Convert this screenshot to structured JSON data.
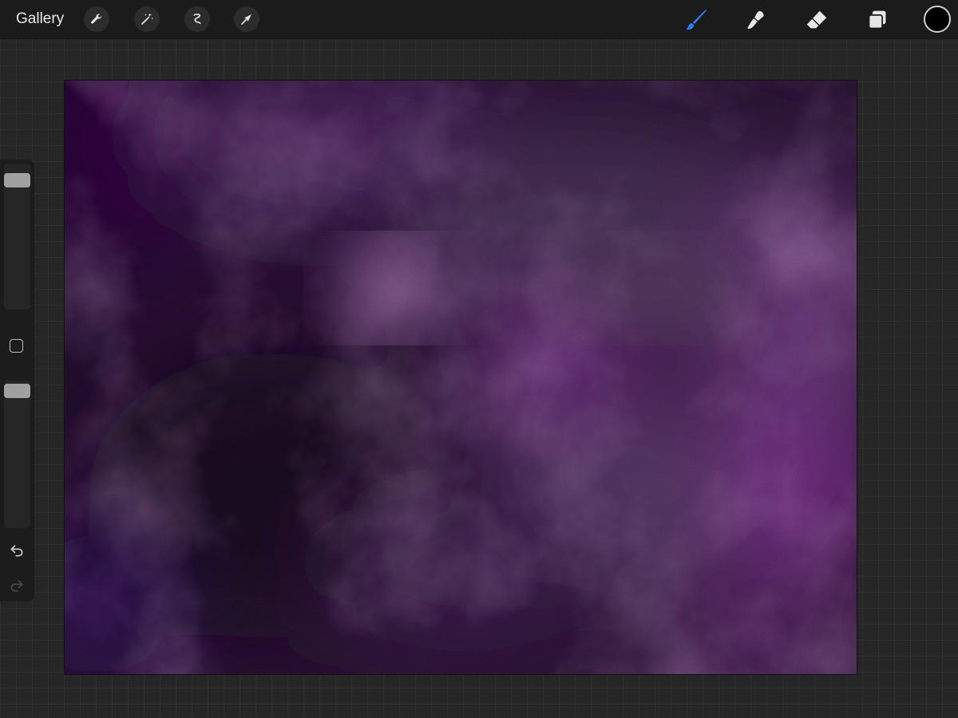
{
  "toolbar": {
    "gallery_label": "Gallery",
    "left_tools": [
      "actions-wrench-icon",
      "adjustments-magic-wand-icon",
      "selection-icon",
      "transform-arrow-icon"
    ],
    "right_tools": [
      "brush-icon",
      "smudge-icon",
      "eraser-icon",
      "layers-icon"
    ],
    "active_tool": "brush-icon",
    "active_color": "#000000",
    "accent_color": "#2f7ef5"
  },
  "canvas": {
    "palette": [
      "#2a1233",
      "#7a3a8e",
      "#9c6aa6",
      "#1a0d22",
      "#3d0a5a"
    ]
  },
  "sidebar": {
    "brush_size": 0.95,
    "brush_opacity": 1.0,
    "icons": [
      "modify-square-icon",
      "undo-icon",
      "redo-icon"
    ]
  }
}
